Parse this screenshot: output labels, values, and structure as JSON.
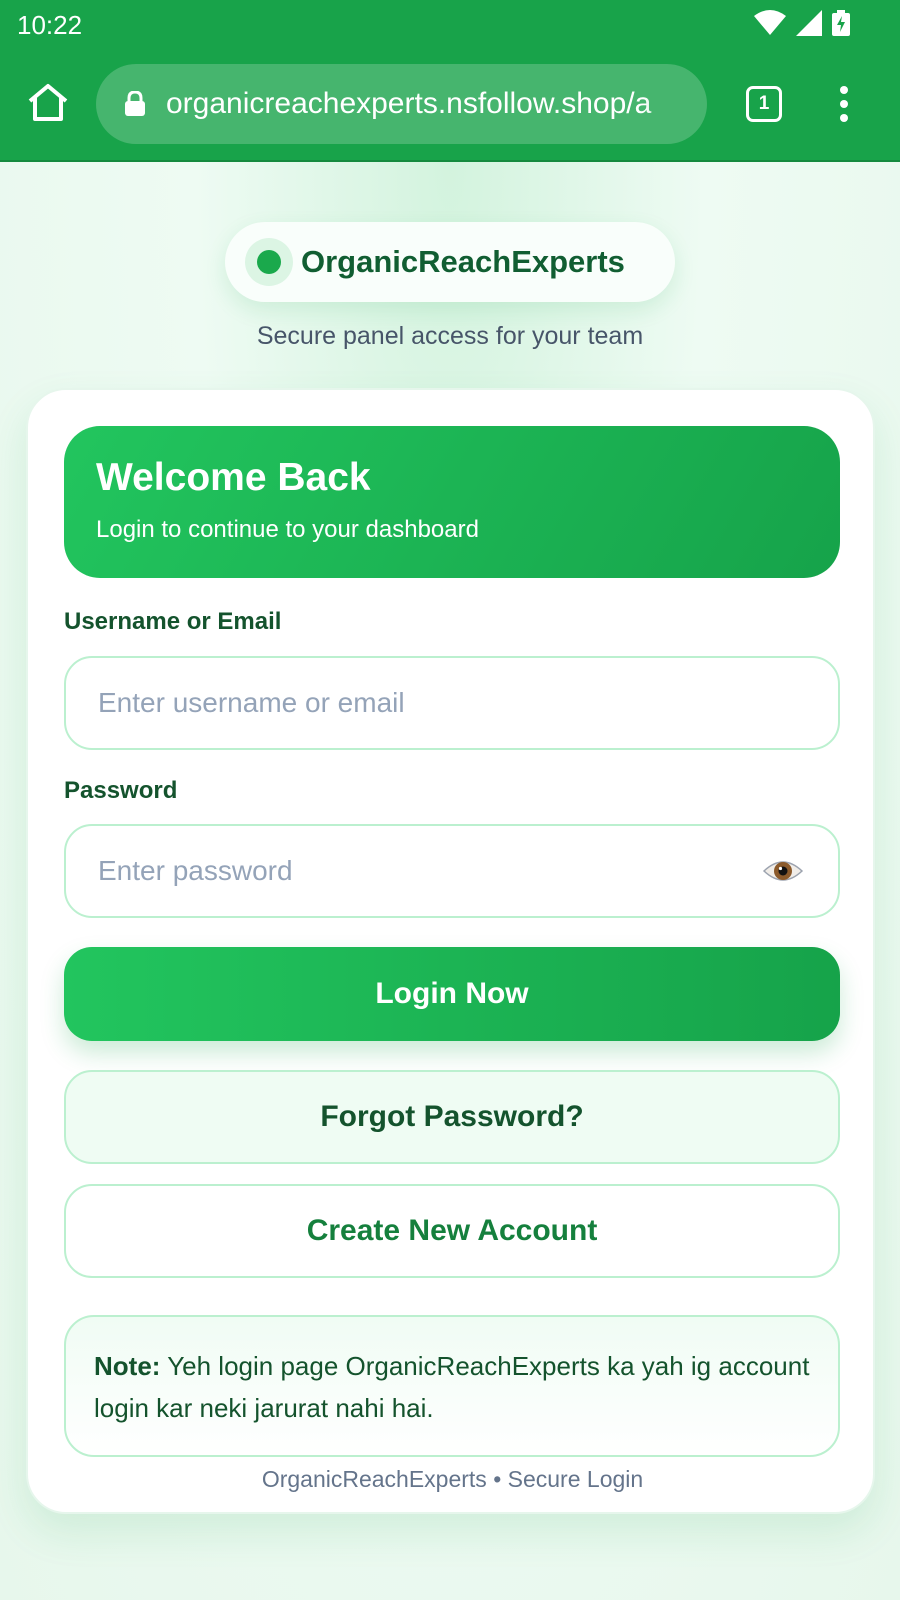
{
  "status_bar": {
    "time": "10:22"
  },
  "browser": {
    "url": "organicreachexperts.nsfollow.shop/a",
    "tab_count": "1"
  },
  "brand": {
    "name": "OrganicReachExperts",
    "tagline": "Secure panel access for your team"
  },
  "hero": {
    "title": "Welcome Back",
    "subtitle": "Login to continue to your dashboard"
  },
  "form": {
    "username_label": "Username or Email",
    "username_placeholder": "Enter username or email",
    "username_value": "",
    "password_label": "Password",
    "password_placeholder": "Enter password",
    "password_value": "",
    "login_button": "Login Now",
    "forgot_button": "Forgot Password?",
    "create_button": "Create New Account"
  },
  "note": {
    "label": "Note:",
    "text": " Yeh login page OrganicReachExperts ka yah ig account login kar neki jarurat nahi hai."
  },
  "footer": {
    "text": "OrganicReachExperts • Secure Login"
  },
  "colors": {
    "primary": "#18a34a",
    "primary_light": "#22c55e",
    "dark_green": "#14532d",
    "border": "#bbf0cf"
  },
  "icons": {
    "home": "home-icon",
    "lock": "lock-icon",
    "tabs": "tabs-icon",
    "menu": "more-vert-icon",
    "eye": "eye-icon",
    "wifi": "wifi-icon",
    "signal": "signal-icon",
    "battery": "battery-charging-icon"
  }
}
